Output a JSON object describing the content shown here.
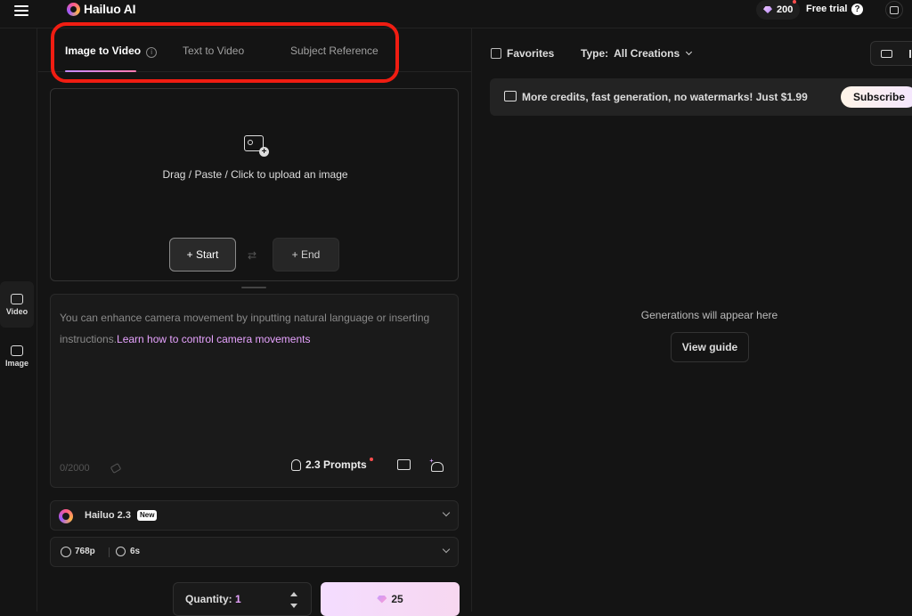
{
  "topbar": {
    "logo_text": "Hailuo AI",
    "credits": "200",
    "free_trial": "Free trial",
    "help_glyph": "?"
  },
  "rail": {
    "items": [
      {
        "label": "Video",
        "icon": "video-icon"
      },
      {
        "label": "Image",
        "icon": "image-icon"
      }
    ]
  },
  "tabs": {
    "items": [
      {
        "label": "Image to Video",
        "active": true
      },
      {
        "label": "Text to Video"
      },
      {
        "label": "Subject Reference"
      }
    ],
    "info_glyph": "i"
  },
  "upload": {
    "text": "Drag / Paste / Click to upload an image",
    "start_label": "+ Start",
    "end_label": "+ End",
    "swap_glyph": "⇄"
  },
  "prompt": {
    "placeholder": "You can enhance camera movement by inputting natural language or inserting instructions.",
    "link": "Learn how to control camera movements",
    "counter": "0/2000",
    "prompts_label": "2.3 Prompts"
  },
  "model": {
    "name": "Hailuo 2.3",
    "badge": "New"
  },
  "settings": {
    "resolution": "768p",
    "duration": "6s"
  },
  "quantity": {
    "label": "Quantity:",
    "value": "1"
  },
  "generate": {
    "cost": "25"
  },
  "right": {
    "favorites": "Favorites",
    "type_label": "Type:",
    "type_value": "All Creations",
    "promo_text": "More credits, fast generation, no watermarks! Just $1.99",
    "subscribe": "Subscribe",
    "empty_text": "Generations will appear here",
    "view_guide": "View guide"
  },
  "colors": {
    "accent": "#e7a3ff",
    "highlight": "#f01d12",
    "background": "#141414"
  }
}
